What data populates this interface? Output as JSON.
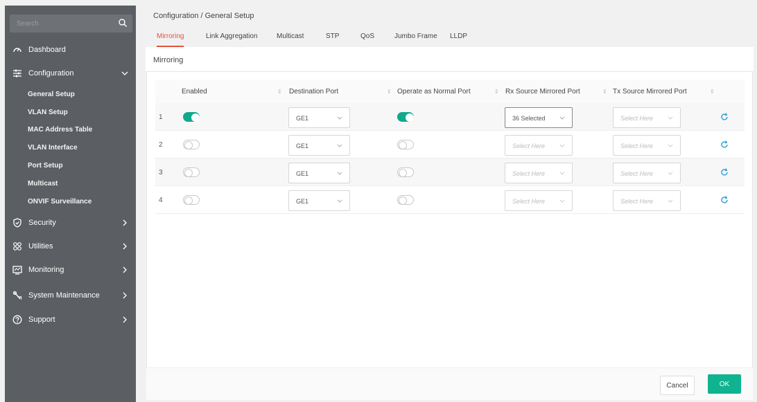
{
  "search": {
    "placeholder": "Search"
  },
  "sidebar": {
    "items": [
      {
        "label": "Dashboard",
        "icon": "dashboard-icon"
      },
      {
        "label": "Configuration",
        "icon": "sliders-icon"
      },
      {
        "label": "Security",
        "icon": "shield-icon"
      },
      {
        "label": "Utilities",
        "icon": "grid-icon"
      },
      {
        "label": "Monitoring",
        "icon": "monitor-icon"
      },
      {
        "label": "System Maintenance",
        "icon": "wrench-icon"
      },
      {
        "label": "Support",
        "icon": "help-icon"
      }
    ],
    "subitems": [
      "General Setup",
      "VLAN Setup",
      "MAC Address Table",
      "VLAN Interface",
      "Port Setup",
      "Multicast",
      "ONVIF Surveillance"
    ]
  },
  "breadcrumb": "Configuration /  General Setup",
  "tabs": [
    "Mirroring",
    "Link Aggregation",
    "Multicast",
    "STP",
    "QoS",
    "Jumbo Frame",
    "LLDP"
  ],
  "panel": {
    "title": "Mirroring"
  },
  "table": {
    "columns": [
      "Enabled",
      "Destination Port",
      "Operate as Normal Port",
      "Rx Source Mirrored Port",
      "Tx Source Mirrored Port"
    ],
    "rows": [
      {
        "num": "1",
        "enabled": true,
        "dest": "GE1",
        "normal": true,
        "rx": "36 Selected",
        "tx": "Select Here"
      },
      {
        "num": "2",
        "enabled": false,
        "dest": "GE1",
        "normal": false,
        "rx": "Select Here",
        "tx": "Select Here"
      },
      {
        "num": "3",
        "enabled": false,
        "dest": "GE1",
        "normal": false,
        "rx": "Select Here",
        "tx": "Select Here"
      },
      {
        "num": "4",
        "enabled": false,
        "dest": "GE1",
        "normal": false,
        "rx": "Select Here",
        "tx": "Select Here"
      }
    ]
  },
  "footer": {
    "cancel": "Cancel",
    "ok": "OK"
  },
  "colors": {
    "accent": "#e7513a",
    "toggle_on": "#10a98c",
    "ok_button": "#10b38f",
    "sidebar": "#5b5e63"
  }
}
